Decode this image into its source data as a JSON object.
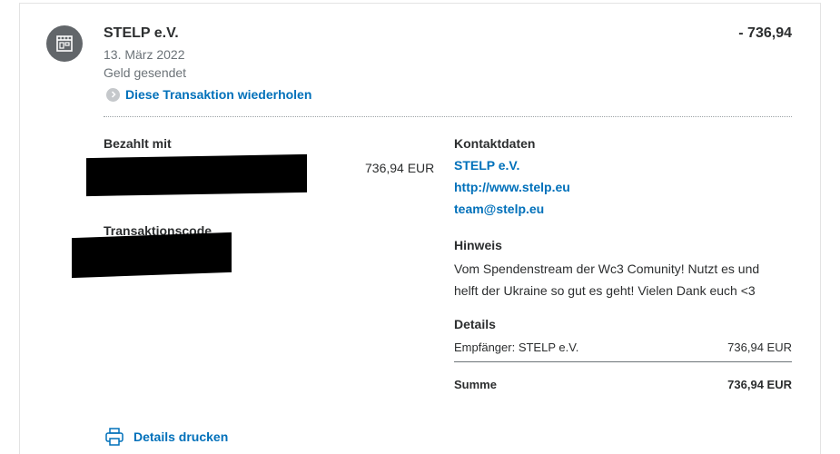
{
  "header": {
    "merchant_name": "STELP e.V.",
    "date": "13. März 2022",
    "status": "Geld gesendet",
    "repeat_link": "Diese Transaktion wiederholen",
    "amount": "- 736,94",
    "avatar_icon": "store-icon",
    "repeat_icon": "chevron-right-icon"
  },
  "paid_with": {
    "heading": "Bezahlt mit",
    "amount": "736,94 EUR"
  },
  "transaction_code": {
    "heading": "Transaktionscode"
  },
  "contact": {
    "heading": "Kontaktdaten",
    "name": "STELP e.V.",
    "website": "http://www.stelp.eu",
    "email": "team@stelp.eu"
  },
  "note": {
    "heading": "Hinweis",
    "text": "Vom Spendenstream der Wc3 Comunity! Nutzt es und helft der Ukraine so gut es geht! Vielen Dank euch <3"
  },
  "details": {
    "heading": "Details",
    "recipient_label": "Empfänger: STELP e.V.",
    "recipient_amount": "736,94 EUR",
    "total_label": "Summe",
    "total_amount": "736,94 EUR"
  },
  "footer": {
    "print_label": "Details drucken",
    "print_icon": "printer-icon"
  },
  "colors": {
    "link": "#0070ba",
    "text": "#2c2e2f",
    "muted": "#6c7378",
    "avatar_bg": "#62666a"
  }
}
